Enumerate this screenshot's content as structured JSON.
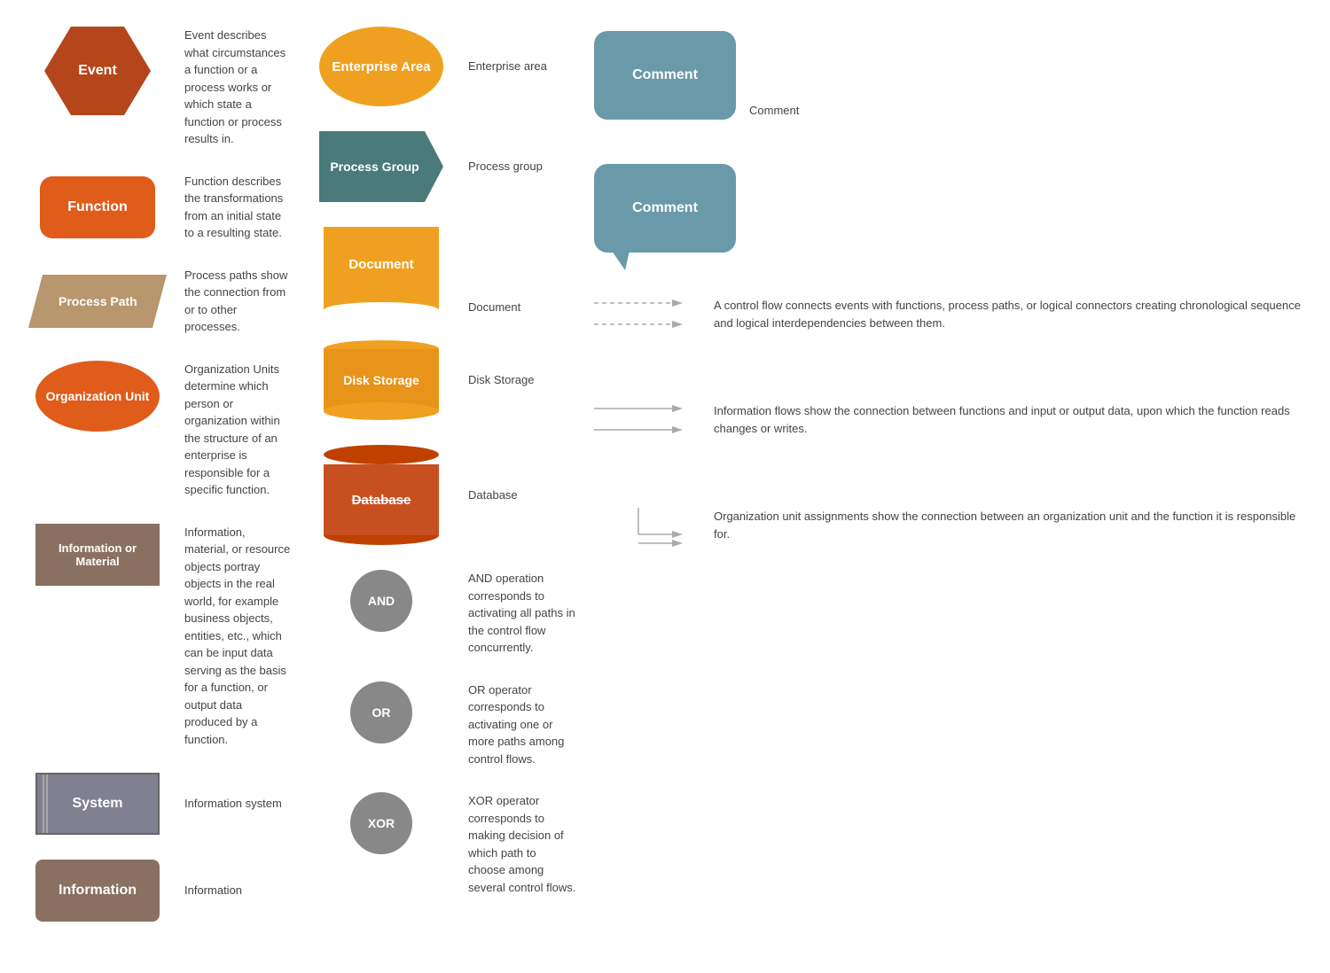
{
  "items": {
    "event": {
      "label": "Event",
      "description": "Event describes what circumstances a function or a process works or which state a function or process results in."
    },
    "function": {
      "label": "Function",
      "description": "Function describes the transformations from an initial state to a resulting state."
    },
    "process_path": {
      "label": "Process Path",
      "description": "Process paths show the connection from or to other processes."
    },
    "org_unit": {
      "label": "Organization Unit",
      "description": "Organization Units determine which person or organization within the structure of an enterprise is responsible for a specific function."
    },
    "info_material": {
      "label": "Information or Material",
      "description": "Information, material, or resource objects portray objects in the real world, for example business objects, entities, etc., which can be input data serving as the basis for a function, or output data produced by a function."
    },
    "system": {
      "label": "System",
      "description": "Information system"
    },
    "information": {
      "label": "Information",
      "description": "Information"
    }
  },
  "col2": {
    "enterprise_area": {
      "label": "Enterprise Area",
      "description": "Enterprise area"
    },
    "process_group": {
      "label": "Process Group",
      "description": "Process group"
    },
    "document": {
      "label": "Document",
      "description": "Document"
    },
    "disk_storage": {
      "label": "Disk Storage",
      "description": "Disk Storage"
    },
    "database": {
      "label": "Database",
      "description": "Database"
    },
    "and": {
      "label": "AND",
      "description": "AND operation corresponds to activating all paths in the control flow concurrently."
    },
    "or": {
      "label": "OR",
      "description": "OR operator corresponds to activating one or more paths among control flows."
    },
    "xor": {
      "label": "XOR",
      "description": "XOR operator corresponds to making decision of which path to choose among several control flows."
    }
  },
  "col3": {
    "comment1": {
      "label": "Comment",
      "description": "Comment"
    },
    "comment2": {
      "label": "Comment",
      "description": ""
    },
    "control_flow": {
      "description": "A control flow connects events with functions, process paths, or logical connectors creating chronological sequence and logical interdependencies between them."
    },
    "info_flow": {
      "description": "Information flows show the connection between functions and input or output data, upon which the function reads changes or writes."
    },
    "org_assign": {
      "description": "Organization unit assignments show the connection between an organization unit and the function it is responsible for."
    }
  }
}
